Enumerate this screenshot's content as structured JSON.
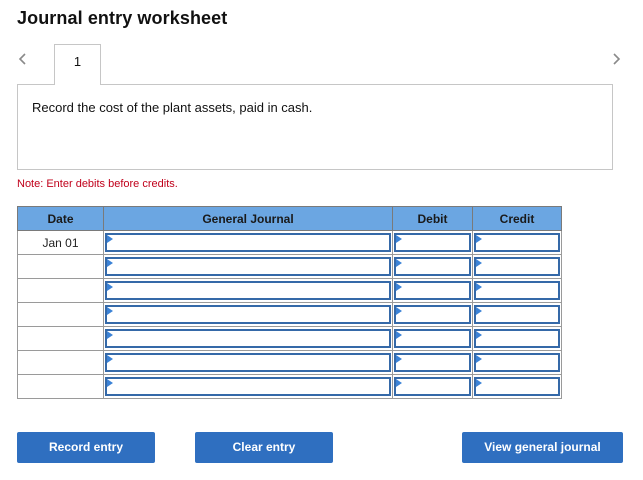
{
  "header": {
    "title": "Journal entry worksheet"
  },
  "nav": {
    "prev_icon": "chevron-left-icon",
    "next_icon": "chevron-right-icon"
  },
  "tabs": [
    {
      "label": "1"
    }
  ],
  "prompt": {
    "text": "Record the cost of the plant assets, paid in cash."
  },
  "note": {
    "text": "Note: Enter debits before credits."
  },
  "table": {
    "headers": {
      "date": "Date",
      "account": "General Journal",
      "debit": "Debit",
      "credit": "Credit"
    },
    "rows": [
      {
        "date": "Jan 01",
        "account": "",
        "debit": "",
        "credit": ""
      },
      {
        "date": "",
        "account": "",
        "debit": "",
        "credit": ""
      },
      {
        "date": "",
        "account": "",
        "debit": "",
        "credit": ""
      },
      {
        "date": "",
        "account": "",
        "debit": "",
        "credit": ""
      },
      {
        "date": "",
        "account": "",
        "debit": "",
        "credit": ""
      },
      {
        "date": "",
        "account": "",
        "debit": "",
        "credit": ""
      },
      {
        "date": "",
        "account": "",
        "debit": "",
        "credit": ""
      }
    ]
  },
  "buttons": {
    "record": "Record entry",
    "clear": "Clear entry",
    "view": "View general journal"
  },
  "colors": {
    "header_bg": "#6ba6e2",
    "button_bg": "#2f6fc0",
    "field_border": "#3569a8",
    "note_text": "#c0001a"
  }
}
